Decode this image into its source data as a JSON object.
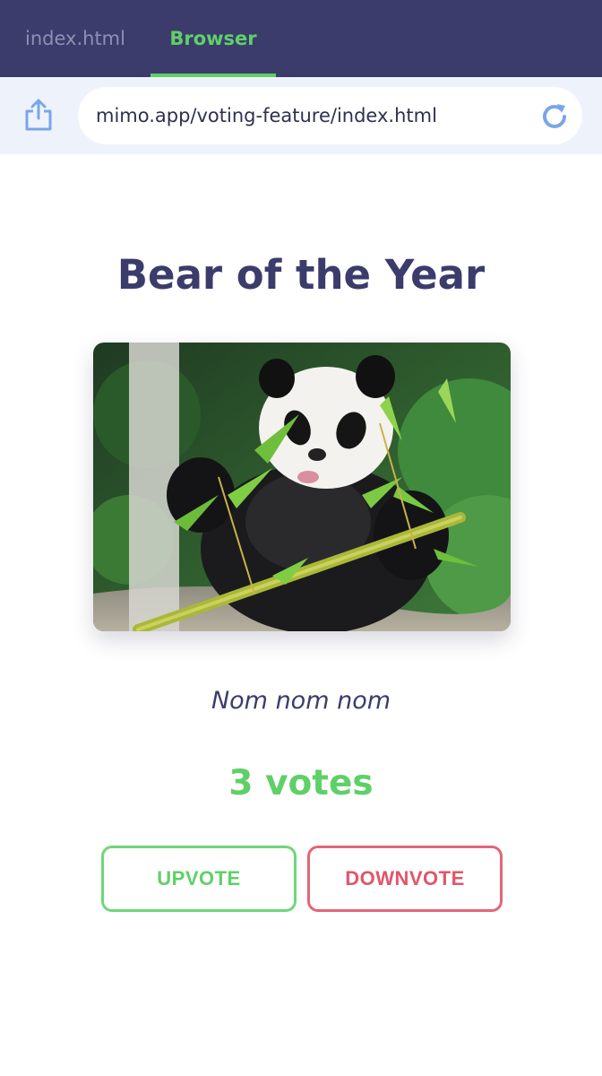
{
  "tabs": [
    {
      "label": "index.html",
      "active": false
    },
    {
      "label": "Browser",
      "active": true
    }
  ],
  "address_bar": {
    "url": "mimo.app/voting-feature/index.html",
    "share_icon": "share-icon",
    "reload_icon": "reload-icon"
  },
  "page": {
    "title": "Bear of the Year",
    "image_subject": "panda-eating-bamboo",
    "caption": "Nom nom nom",
    "votes": "3 votes",
    "upvote_label": "UPVOTE",
    "downvote_label": "DOWNVOTE"
  },
  "colors": {
    "tabbar_bg": "#3b3c6b",
    "accent_green": "#5fd068",
    "accent_red": "#e0566a",
    "address_bg": "#eef3fb",
    "text_dark": "#3b3c6b"
  }
}
